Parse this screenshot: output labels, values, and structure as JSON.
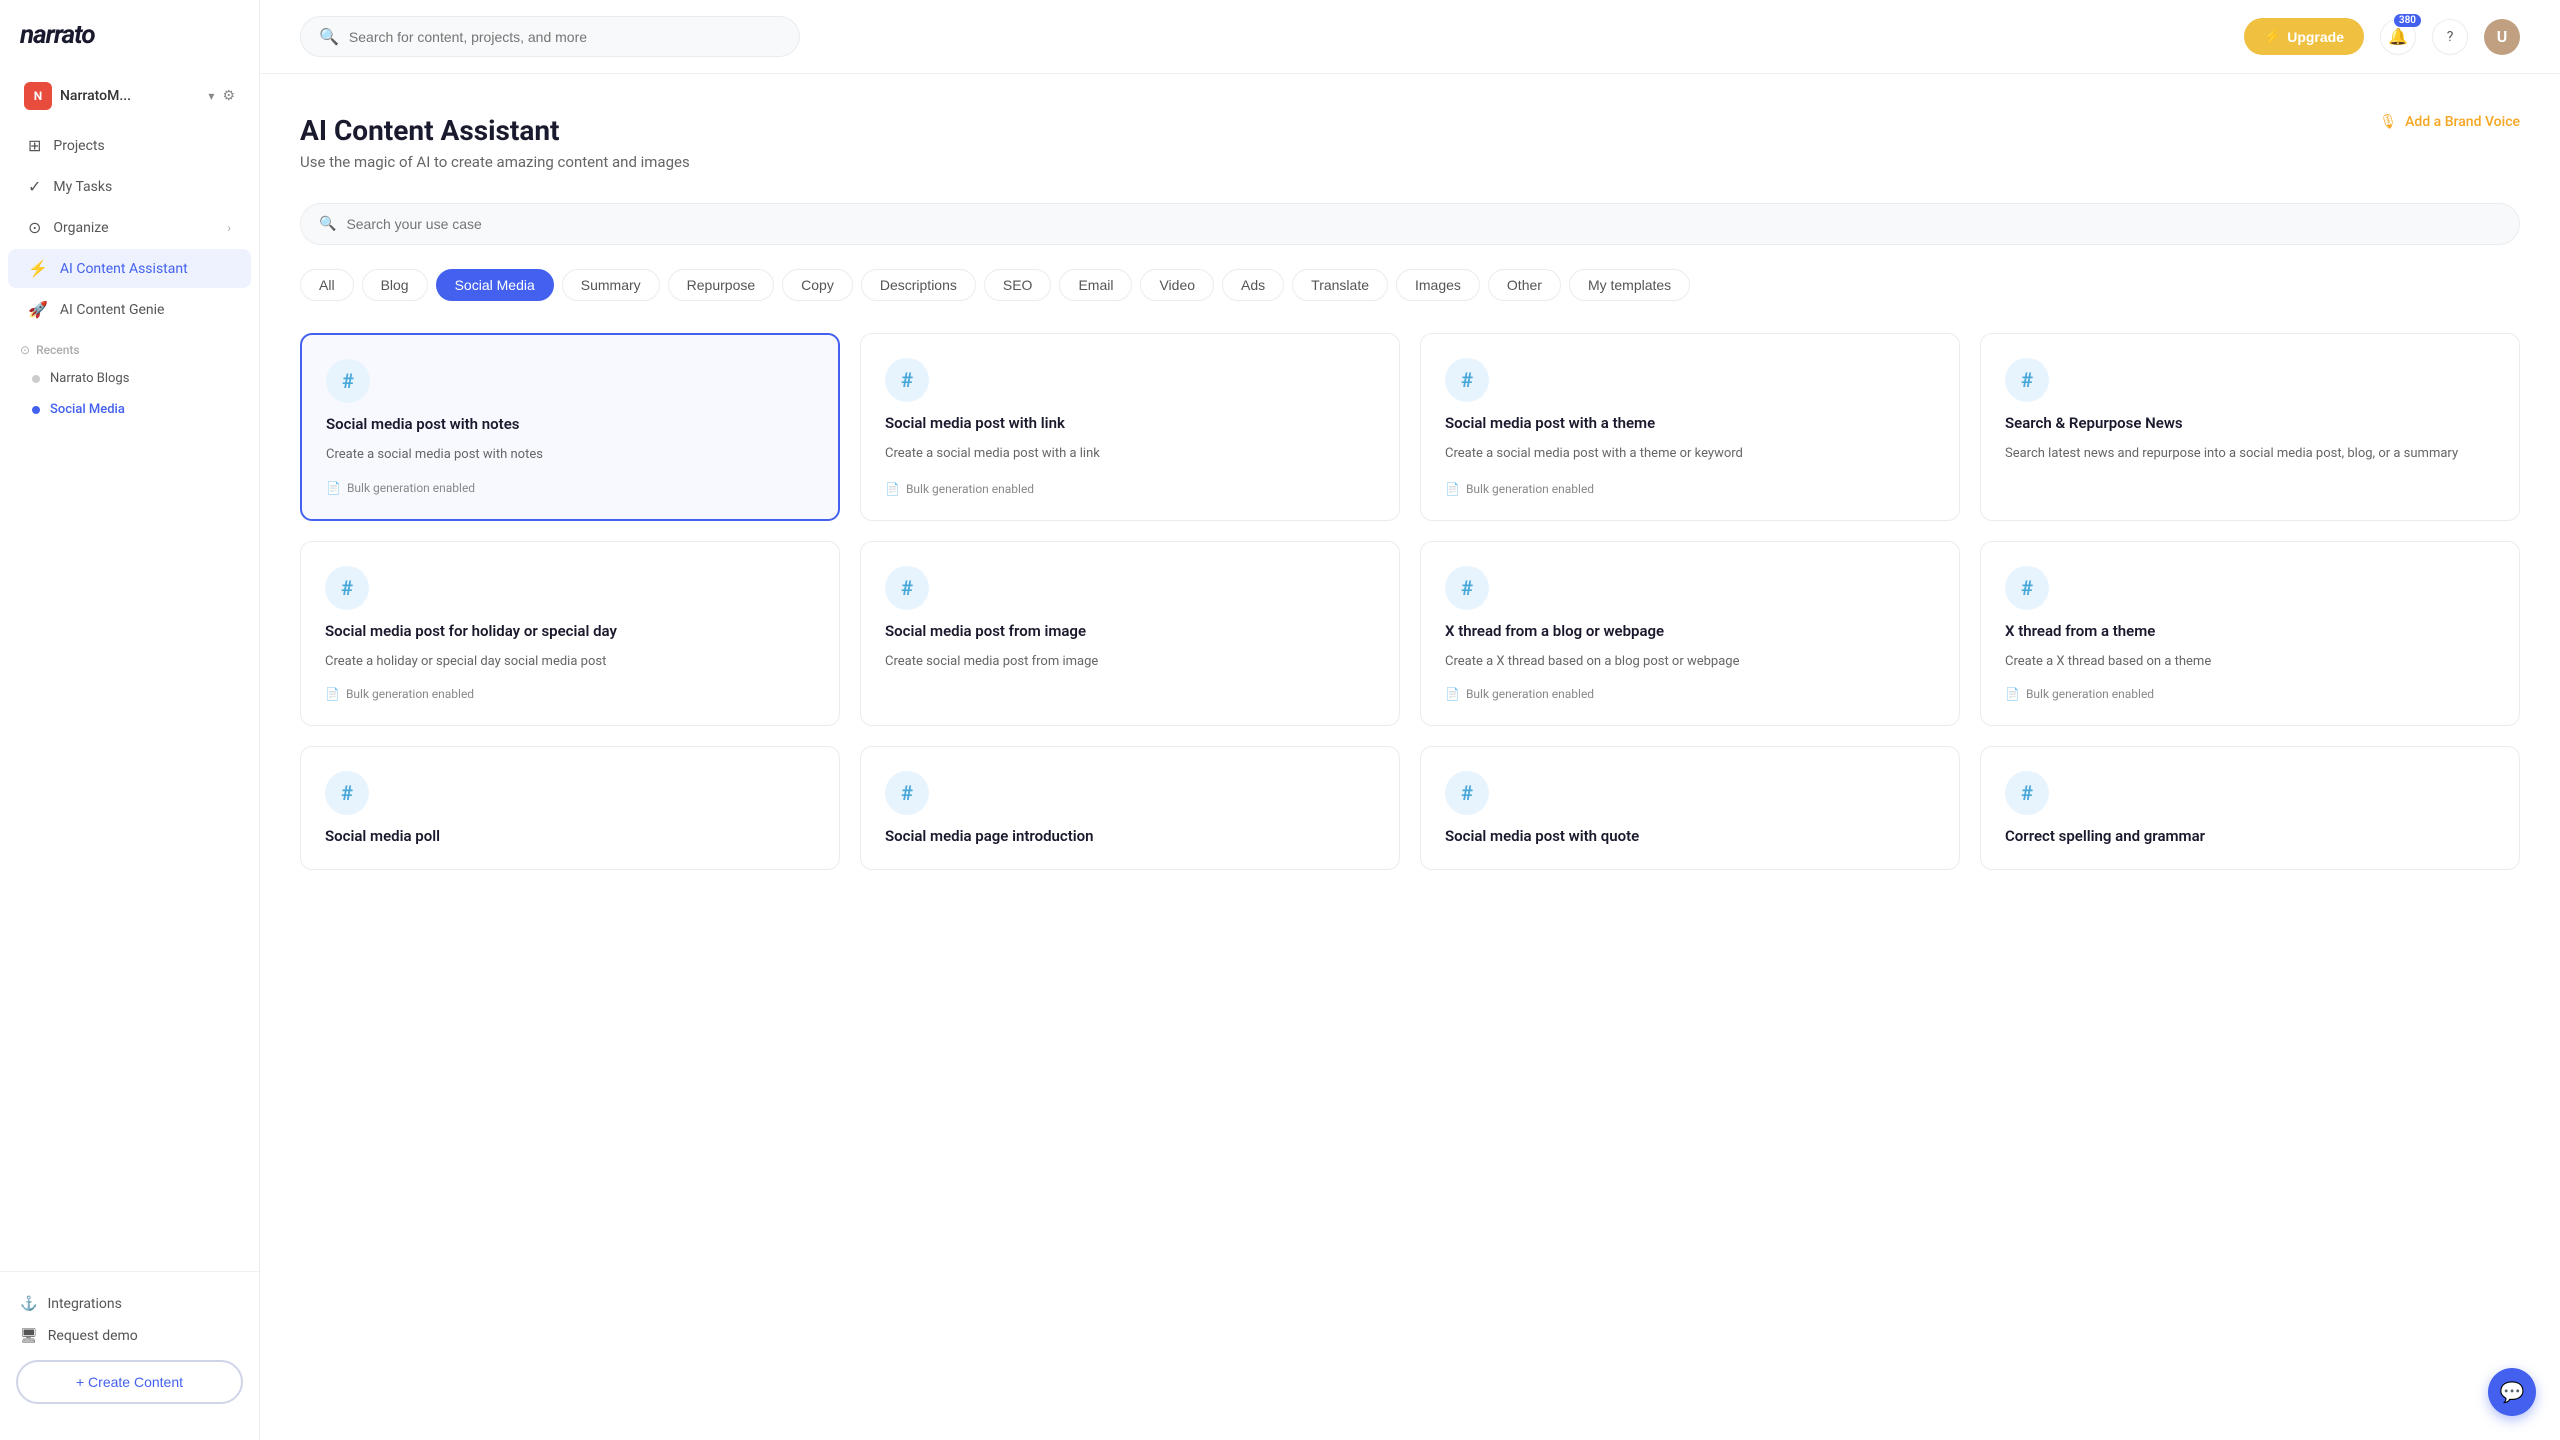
{
  "sidebar": {
    "logo": "narrato",
    "account": {
      "initials": "N",
      "name": "NarratoM...",
      "chevron": "▾",
      "gear": "⚙"
    },
    "nav_items": [
      {
        "id": "projects",
        "label": "Projects",
        "icon": "⊞"
      },
      {
        "id": "my-tasks",
        "label": "My Tasks",
        "icon": "✓"
      },
      {
        "id": "organize",
        "label": "Organize",
        "icon": "⊙",
        "has_arrow": true
      },
      {
        "id": "ai-content-assistant",
        "label": "AI Content Assistant",
        "icon": "⚡",
        "active": true
      },
      {
        "id": "ai-content-genie",
        "label": "AI Content Genie",
        "icon": "🚀"
      }
    ],
    "recents_label": "Recents",
    "recents_icon": "⊙",
    "recents": [
      {
        "id": "narrato-blogs",
        "label": "Narrato Blogs",
        "active": false
      },
      {
        "id": "social-media",
        "label": "Social Media",
        "active": true
      }
    ],
    "bottom_items": [
      {
        "id": "integrations",
        "label": "Integrations",
        "icon": "⚓"
      },
      {
        "id": "request-demo",
        "label": "Request demo",
        "icon": "🖥"
      }
    ],
    "create_btn": "+ Create Content"
  },
  "header": {
    "search_placeholder": "Search for content, projects, and more",
    "upgrade_label": "Upgrade",
    "upgrade_icon": "⚡",
    "notification_count": "380",
    "help_icon": "?",
    "user_initial": "U"
  },
  "page": {
    "title": "AI Content Assistant",
    "subtitle": "Use the magic of AI to create amazing content and images",
    "brand_voice_label": "Add a Brand Voice",
    "brand_voice_icon": "🎙"
  },
  "filter_bar": {
    "placeholder": "Search your use case"
  },
  "filter_tags": [
    {
      "id": "all",
      "label": "All",
      "active": false
    },
    {
      "id": "blog",
      "label": "Blog",
      "active": false
    },
    {
      "id": "social-media",
      "label": "Social Media",
      "active": true
    },
    {
      "id": "summary",
      "label": "Summary",
      "active": false
    },
    {
      "id": "repurpose",
      "label": "Repurpose",
      "active": false
    },
    {
      "id": "copy",
      "label": "Copy",
      "active": false
    },
    {
      "id": "descriptions",
      "label": "Descriptions",
      "active": false
    },
    {
      "id": "seo",
      "label": "SEO",
      "active": false
    },
    {
      "id": "email",
      "label": "Email",
      "active": false
    },
    {
      "id": "video",
      "label": "Video",
      "active": false
    },
    {
      "id": "ads",
      "label": "Ads",
      "active": false
    },
    {
      "id": "translate",
      "label": "Translate",
      "active": false
    },
    {
      "id": "images",
      "label": "Images",
      "active": false
    },
    {
      "id": "other",
      "label": "Other",
      "active": false
    },
    {
      "id": "my-templates",
      "label": "My templates",
      "active": false
    }
  ],
  "cards": [
    {
      "id": "social-notes",
      "title": "Social media post with notes",
      "description": "Create a social media post with notes",
      "bulk": true,
      "selected": true
    },
    {
      "id": "social-link",
      "title": "Social media post with link",
      "description": "Create a social media post with a link",
      "bulk": true,
      "selected": false
    },
    {
      "id": "social-theme",
      "title": "Social media post with a theme",
      "description": "Create a social media post with a theme or keyword",
      "bulk": true,
      "selected": false
    },
    {
      "id": "search-repurpose",
      "title": "Search & Repurpose News",
      "description": "Search latest news and repurpose into a social media post, blog, or a summary",
      "bulk": false,
      "selected": false
    },
    {
      "id": "social-holiday",
      "title": "Social media post for holiday or special day",
      "description": "Create a holiday or special day social media post",
      "bulk": true,
      "selected": false
    },
    {
      "id": "social-image",
      "title": "Social media post from image",
      "description": "Create social media post from image",
      "bulk": false,
      "selected": false
    },
    {
      "id": "x-thread-blog",
      "title": "X thread from a blog or webpage",
      "description": "Create a X thread based on a blog post or webpage",
      "bulk": true,
      "selected": false
    },
    {
      "id": "x-thread-theme",
      "title": "X thread from a theme",
      "description": "Create a X thread based on a theme",
      "bulk": true,
      "selected": false
    },
    {
      "id": "social-poll",
      "title": "Social media poll",
      "description": "",
      "bulk": false,
      "selected": false
    },
    {
      "id": "social-page-intro",
      "title": "Social media page introduction",
      "description": "",
      "bulk": false,
      "selected": false
    },
    {
      "id": "social-quote",
      "title": "Social media post with quote",
      "description": "",
      "bulk": false,
      "selected": false
    },
    {
      "id": "correct-spelling",
      "title": "Correct spelling and grammar",
      "description": "",
      "bulk": false,
      "selected": false
    }
  ],
  "bulk_label": "Bulk generation enabled",
  "chat_icon": "💬"
}
